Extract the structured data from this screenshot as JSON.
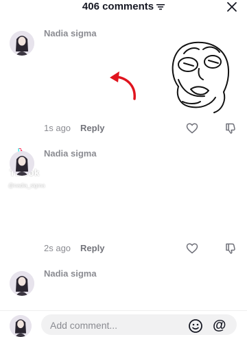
{
  "header": {
    "comments_count_label": "406 comments",
    "sort_icon": "sort-lines-icon",
    "close_icon": "close-icon"
  },
  "comments": [
    {
      "username": "Nadia sigma",
      "time": "1s ago",
      "reply_label": "Reply"
    },
    {
      "username": "Nadia sigma",
      "time": "2s ago",
      "reply_label": "Reply"
    },
    {
      "username": "Nadia sigma"
    }
  ],
  "watermark": {
    "brand": "TikTok",
    "handle": "@nadia_sigma"
  },
  "composer": {
    "placeholder": "Add comment...",
    "at_symbol": "@"
  },
  "colors": {
    "text_primary": "#161823",
    "text_secondary": "#8a8b91",
    "arrow": "#e0141e"
  }
}
